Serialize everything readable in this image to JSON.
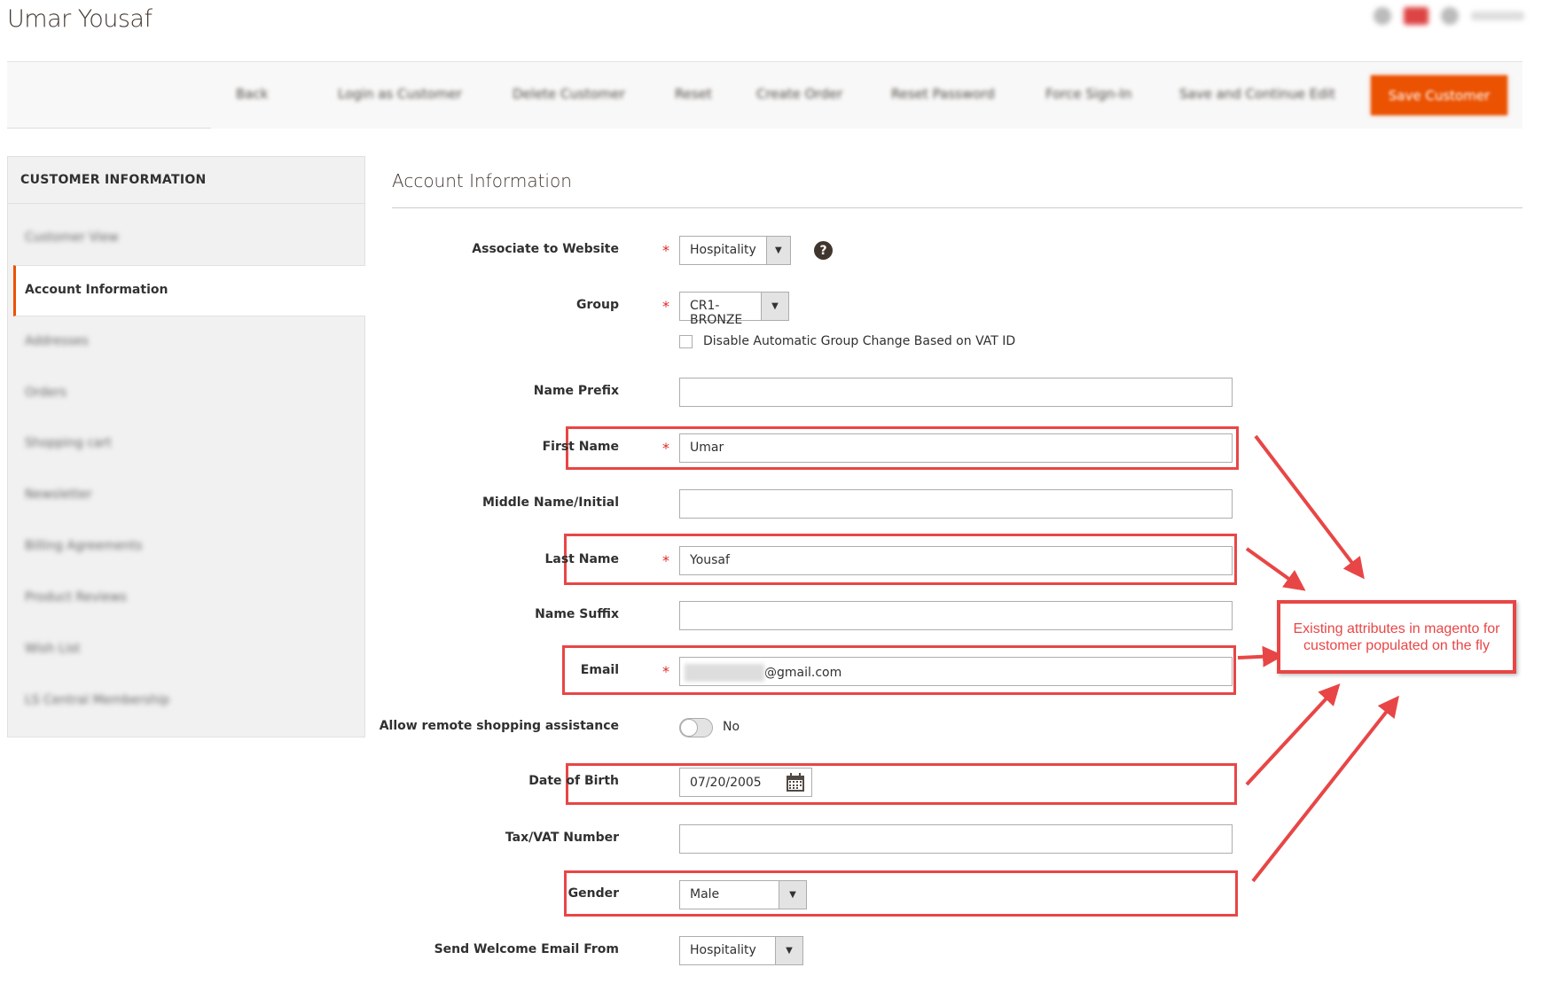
{
  "header": {
    "title": "Umar Yousaf"
  },
  "toolbar": {
    "buttons": [
      "Back",
      "Login as Customer",
      "Delete Customer",
      "Reset",
      "Create Order",
      "Reset Password",
      "Force Sign-In",
      "Save and Continue Edit"
    ],
    "primary": "Save Customer"
  },
  "sidebar": {
    "heading": "CUSTOMER INFORMATION",
    "items": [
      "Customer View",
      "Account Information",
      "Addresses",
      "Orders",
      "Shopping cart",
      "Newsletter",
      "Billing Agreements",
      "Product Reviews",
      "Wish List",
      "LS Central Membership"
    ],
    "active_index": 1
  },
  "section": {
    "title": "Account Information"
  },
  "form": {
    "website": {
      "label": "Associate to Website",
      "value": "Hospitality"
    },
    "group": {
      "label": "Group",
      "value": "CR1-BRONZE"
    },
    "vat_checkbox": {
      "label": "Disable Automatic Group Change Based on VAT ID",
      "checked": false
    },
    "prefix": {
      "label": "Name Prefix",
      "value": ""
    },
    "first": {
      "label": "First Name",
      "value": "Umar"
    },
    "middle": {
      "label": "Middle Name/Initial",
      "value": ""
    },
    "last": {
      "label": "Last Name",
      "value": "Yousaf"
    },
    "suffix": {
      "label": "Name Suffix",
      "value": ""
    },
    "email": {
      "label": "Email",
      "value": "@gmail.com"
    },
    "remote": {
      "label": "Allow remote shopping assistance",
      "value": "No"
    },
    "dob": {
      "label": "Date of Birth",
      "value": "07/20/2005"
    },
    "tax": {
      "label": "Tax/VAT Number",
      "value": ""
    },
    "gender": {
      "label": "Gender",
      "value": "Male"
    },
    "welcome": {
      "label": "Send Welcome Email From",
      "value": "Hospitality"
    },
    "required_mark": "*"
  },
  "annotation": {
    "text": "Existing attributes in magento for customer populated on the fly"
  },
  "colors": {
    "accent": "#eb5202",
    "annotation": "#e84646"
  }
}
